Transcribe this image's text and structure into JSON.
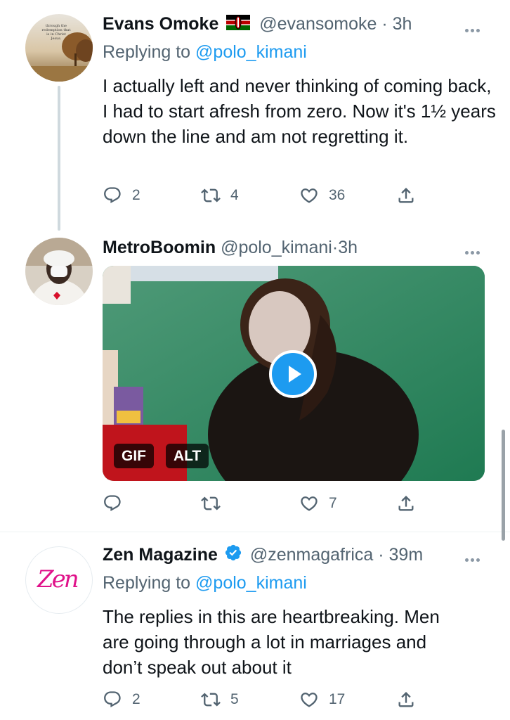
{
  "tweets": [
    {
      "name": "Evans Omoke",
      "flag": "Kenya flag",
      "handle": "@evansomoke",
      "sep": "·",
      "time": "3h",
      "replying_prefix": "Replying to ",
      "replying_to": "@polo_kimani",
      "text": "I actually left and never thinking of coming back, I had to start afresh from zero. Now it's 1½ years down the line and am not regretting it.",
      "avatar_text": "through the redemption that is in Christ Jesus.",
      "replies": "2",
      "retweets": "4",
      "likes": "36"
    },
    {
      "name": "MetroBoomin",
      "handle": "@polo_kimani",
      "sep": "·",
      "time": "3h",
      "media_badges": {
        "gif": "GIF",
        "alt": "ALT"
      },
      "likes": "7"
    },
    {
      "name": "Zen Magazine",
      "verified": true,
      "handle": "@zenmagafrica",
      "sep": "·",
      "time": "39m",
      "replying_prefix": "Replying to ",
      "replying_to": "@polo_kimani",
      "text": "The replies in this are heartbreaking. Men are going through a lot in marriages and don’t speak out about it",
      "avatar_logo": "Zen",
      "replies": "2",
      "retweets": "5",
      "likes": "17"
    }
  ],
  "icons": {
    "reply": "reply-icon",
    "retweet": "retweet-icon",
    "like": "heart-icon",
    "share": "share-icon",
    "more": "more-icon",
    "play": "play-icon",
    "verified": "verified-badge-icon"
  },
  "colors": {
    "accent": "#1d9bf0",
    "text": "#0f1419",
    "secondary": "#536471",
    "divider": "#eff3f4"
  }
}
